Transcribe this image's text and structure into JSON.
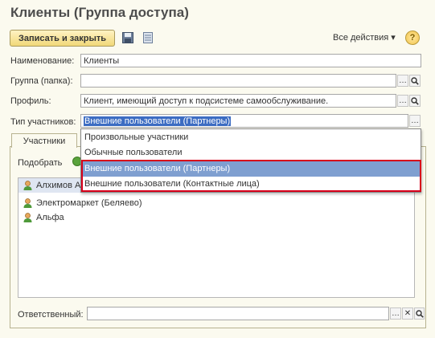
{
  "window": {
    "title": "Клиенты (Группа доступа)"
  },
  "toolbar": {
    "save_close_label": "Записать и закрыть",
    "all_actions_label": "Все действия ▾",
    "help_label": "?"
  },
  "form": {
    "name_label": "Наименование:",
    "name_value": "Клиенты",
    "group_label": "Группа (папка):",
    "group_value": "",
    "profile_label": "Профиль:",
    "profile_value": "Клиент, имеющий доступ к подсистеме самообслуживание.",
    "member_type_label": "Тип участников:",
    "member_type_value": "Внешние пользователи (Партнеры)"
  },
  "tabs": [
    {
      "label": "Участники"
    }
  ],
  "members": {
    "pick_label": "Подобрать",
    "items": [
      {
        "label": "Алхимов А"
      },
      {
        "label": "Электромаркет (Беляево)"
      },
      {
        "label": "Альфа"
      }
    ]
  },
  "dropdown": {
    "options": [
      {
        "label": "Произвольные участники"
      },
      {
        "label": "Обычные пользователи"
      },
      {
        "label": "Внешние пользователи (Партнеры)",
        "selected": true
      },
      {
        "label": "Внешние пользователи (Контактные лица)"
      }
    ]
  },
  "responsible": {
    "label": "Ответственный:",
    "value": ""
  },
  "colors": {
    "accent": "#f1d879",
    "selection": "#7f9fd0",
    "highlight_box": "#d8001a",
    "title": "#4d4d4d"
  }
}
